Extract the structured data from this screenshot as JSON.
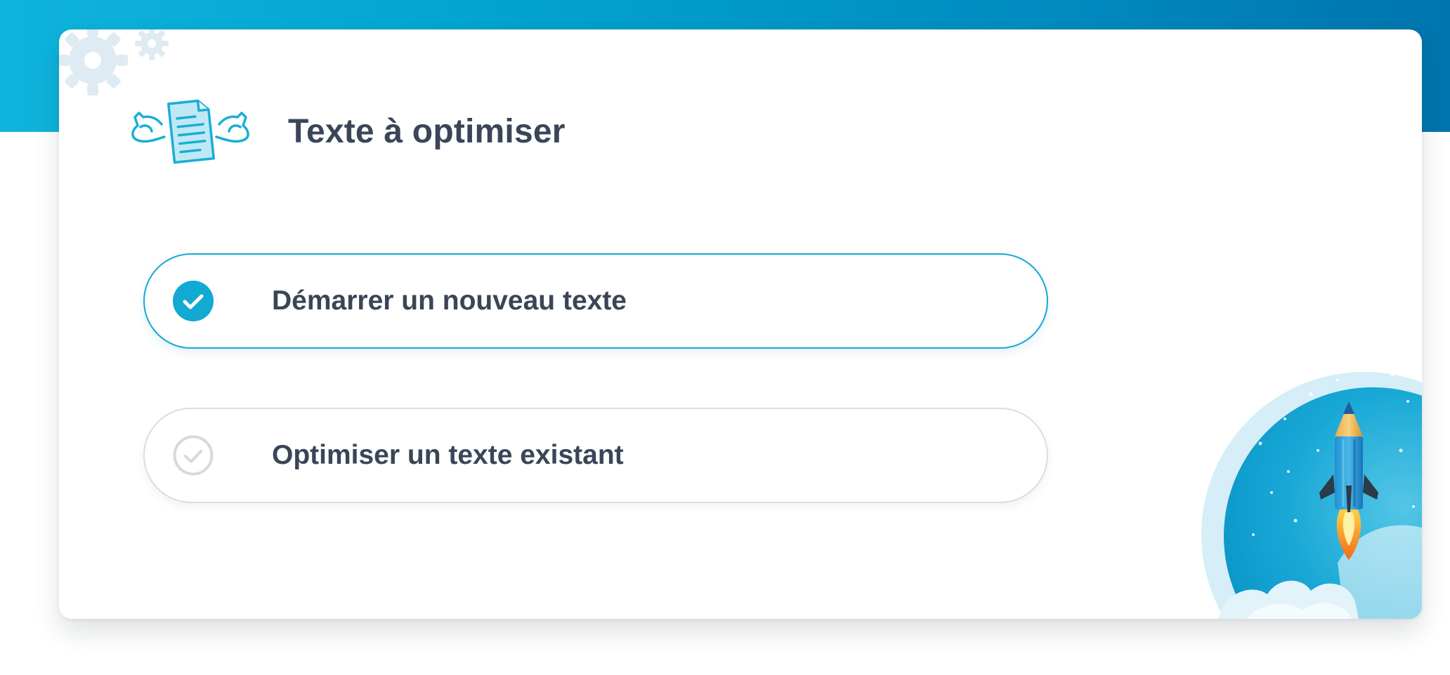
{
  "page": {
    "title": "Texte à optimiser",
    "title_icon": "muscle-document-icon"
  },
  "options": [
    {
      "label": "Démarrer un nouveau texte",
      "selected": true,
      "icon": "check-circle-filled-icon"
    },
    {
      "label": "Optimiser un texte existant",
      "selected": false,
      "icon": "check-circle-outline-icon"
    }
  ],
  "decorations": {
    "gear": "gear-icon",
    "rocket": "pencil-rocket-illustration"
  },
  "colors": {
    "accent": "#12a9d3",
    "header_gradient_start": "#0fb4dc",
    "header_gradient_end": "#0074ad",
    "text": "#3a4657",
    "inactive_border": "#dadde2"
  }
}
